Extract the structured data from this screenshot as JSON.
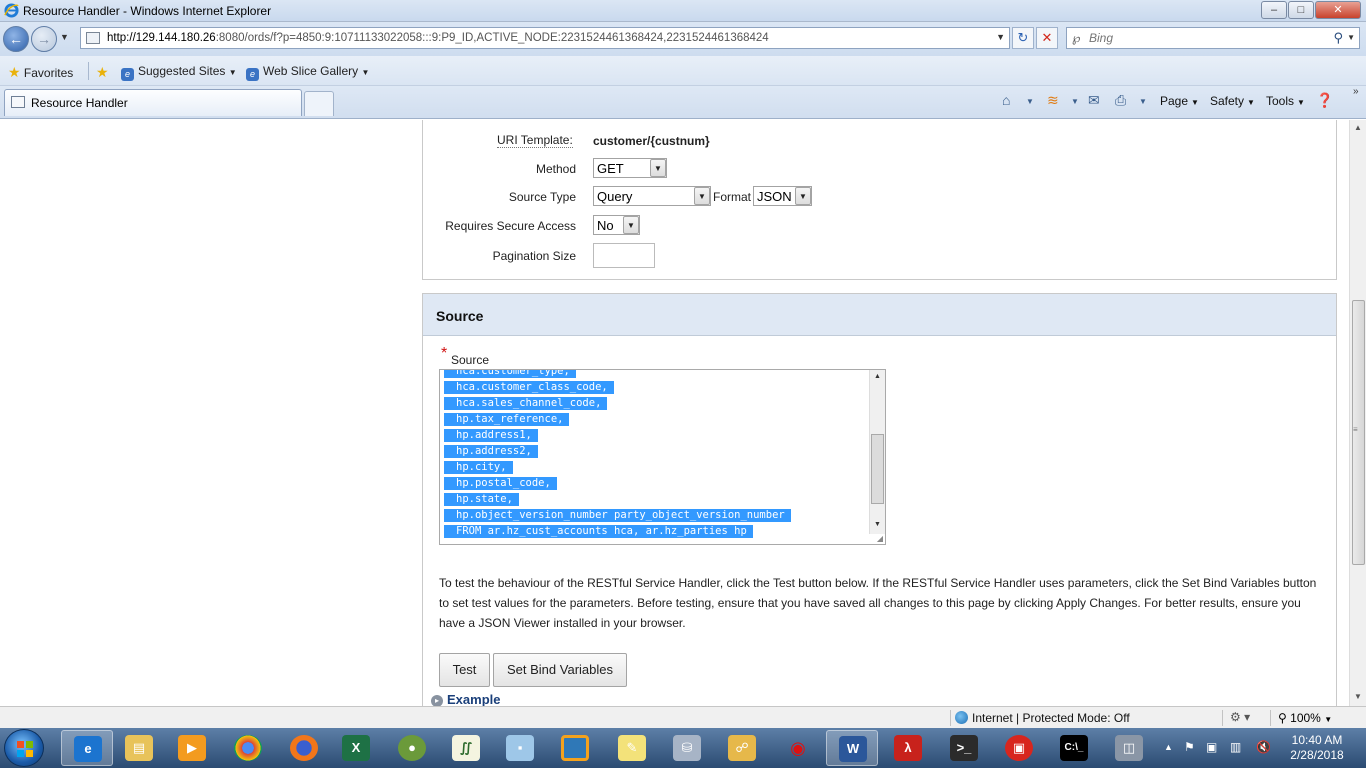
{
  "window": {
    "title": "Resource Handler - Windows Internet Explorer",
    "minimize": "–",
    "maximize": "□",
    "close": "✕"
  },
  "address": {
    "url_host": "http://129.144.180.26",
    "url_rest": ":8080/ords/f?p=4850:9:10711133022058:::9:P9_ID,ACTIVE_NODE:2231524461368424,2231524461368424",
    "search_placeholder": "Bing"
  },
  "favorites": {
    "label": "Favorites",
    "items": [
      {
        "label": "Suggested Sites"
      },
      {
        "label": "Web Slice Gallery"
      }
    ]
  },
  "tabs": [
    {
      "label": "Resource Handler"
    }
  ],
  "commands": {
    "page": "Page",
    "safety": "Safety",
    "tools": "Tools"
  },
  "form": {
    "uri_template_label": "URI Template:",
    "uri_template_value": "customer/{custnum}",
    "method_label": "Method",
    "method_value": "GET",
    "source_type_label": "Source Type",
    "source_type_value": "Query",
    "format_label": "Format",
    "format_value": "JSON",
    "secure_label": "Requires Secure Access",
    "secure_value": "No",
    "pagination_label": "Pagination Size",
    "pagination_value": ""
  },
  "source": {
    "header": "Source",
    "field_label": "Source",
    "lines": [
      "hca.customer_type,",
      "hca.customer_class_code,",
      "hca.sales_channel_code,",
      "hp.tax_reference,",
      "hp.address1,",
      "hp.address2,",
      "hp.city,",
      "hp.postal_code,",
      "hp.state,",
      "hp.object_version_number party_object_version_number",
      "FROM ar.hz_cust_accounts hca, ar.hz_parties hp"
    ]
  },
  "help_text": "To test the behaviour of the RESTful Service Handler, click the Test button below. If the RESTful Service Handler uses parameters, click the Set Bind Variables button to set test values for the parameters. Before testing, ensure that you have saved all changes to this page by clicking Apply Changes. For better results, ensure you have a JSON Viewer installed in your browser.",
  "buttons": {
    "test": "Test",
    "set_bind": "Set Bind Variables"
  },
  "example_label": "Example",
  "status": {
    "zone": "Internet | Protected Mode: Off",
    "zoom": "100%"
  },
  "clock": {
    "time": "10:40 AM",
    "date": "2/28/2018"
  },
  "taskbar_apps": [
    "ie-icon",
    "explorer-icon",
    "media-player-icon",
    "chrome-icon",
    "firefox-icon",
    "excel-icon",
    "frog-app-icon",
    "chart-app-icon",
    "notes-app-icon",
    "vmware-icon",
    "folder-notes-icon",
    "database-icon",
    "network-icon",
    "cherry-app-icon",
    "word-icon",
    "acrobat-icon",
    "terminal-icon",
    "shield-app-icon",
    "cmd-icon",
    "remote-app-icon"
  ]
}
